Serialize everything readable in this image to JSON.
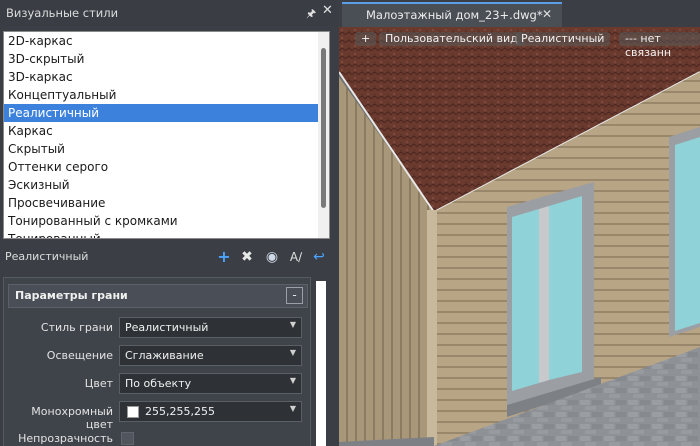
{
  "palette": {
    "title": "Визуальные стили",
    "styles": [
      "2D-каркас",
      "3D-скрытый",
      "3D-каркас",
      "Концептуальный",
      "Реалистичный",
      "Каркас",
      "Скрытый",
      "Оттенки серого",
      "Эскизный",
      "Просвечивание",
      "Тонированный с кромками",
      "Тонированный"
    ],
    "selected_style": "Реалистичный",
    "current_style": "Реалистичный",
    "section_title": "Параметры грани",
    "collapse": "-",
    "properties": [
      {
        "label": "Стиль грани",
        "value": "Реалистичный"
      },
      {
        "label": "Освещение",
        "value": "Сглаживание"
      },
      {
        "label": "Цвет",
        "value": "По объекту"
      },
      {
        "label": "Монохромный цвет",
        "value": "255,255,255",
        "swatch": "#ffffff"
      }
    ],
    "opacity_label": "Непрозрачность"
  },
  "document": {
    "tab_title": "Малоэтажный дом_23+.dwg*",
    "overlay": [
      "+",
      "Пользовательский вид",
      "Реалистичный",
      "--- нет связанн"
    ]
  },
  "colors": {
    "selection": "#3c82dc",
    "accent": "#4aa3ff",
    "roof": "#6a3a2e",
    "siding": "#b5a283",
    "window_glass": "#8fd2d8",
    "trim": "#9b9ea2",
    "stone": "#8e9196"
  },
  "icons": [
    "pin-icon",
    "close-icon",
    "plus-icon",
    "delete-icon",
    "apply-to-viewport-icon",
    "edit-text-icon",
    "undo-icon"
  ]
}
